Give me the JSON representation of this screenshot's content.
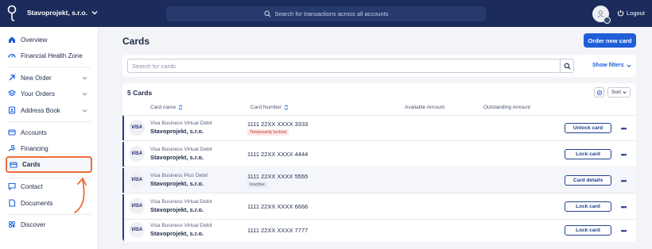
{
  "topbar": {
    "company": "Stavoprojekt, s.r.o.",
    "search_placeholder": "Search for transactions across all accounts",
    "logout_label": "Logout"
  },
  "sidebar": {
    "items": [
      {
        "label": "Overview",
        "icon": "home-icon"
      },
      {
        "label": "Financial Health Zone",
        "icon": "gauge-icon"
      },
      {
        "label": "New Order",
        "icon": "arrow-diagonal-icon"
      },
      {
        "label": "Your Orders",
        "icon": "orders-icon"
      },
      {
        "label": "Address Book",
        "icon": "address-book-icon"
      },
      {
        "label": "Accounts",
        "icon": "accounts-icon"
      },
      {
        "label": "Financing",
        "icon": "financing-icon"
      },
      {
        "label": "Cards",
        "icon": "card-icon"
      },
      {
        "label": "Contact",
        "icon": "chat-icon"
      },
      {
        "label": "Documents",
        "icon": "document-icon"
      },
      {
        "label": "Discover",
        "icon": "discover-icon"
      }
    ]
  },
  "main": {
    "title": "Cards",
    "order_button": "Order new card",
    "search_placeholder": "Search for cards",
    "show_filters": "Show filters",
    "count_label": "5 Cards",
    "sort_label": "Sort",
    "columns": {
      "card_name": "Card name",
      "card_number": "Card Number",
      "available": "Available Amount",
      "outstanding": "Outstanding Amount"
    },
    "rows": [
      {
        "brand": "VISA",
        "type": "Visa Business Virtual Debit",
        "name": "Stavoprojekt, s.r.o.",
        "number": "1111 22XX XXXX 3333",
        "tag": "Temporarily locked",
        "action": "Unlock card"
      },
      {
        "brand": "VISA",
        "type": "Visa Business Virtual Debit",
        "name": "Stavoprojekt, s.r.o.",
        "number": "1111 22XX XXXX 4444",
        "tag": "",
        "action": "Lock card"
      },
      {
        "brand": "VISA",
        "type": "Visa Business Plus Debit",
        "name": "Stavoprojekt, s.r.o.",
        "number": "1111 22XX XXXX 5555",
        "tag": "Inactive",
        "action": "Card details"
      },
      {
        "brand": "VISA",
        "type": "Visa Business Virtual Debit",
        "name": "Stavoprojekt, s.r.o.",
        "number": "1111 22XX XXXX 6666",
        "tag": "",
        "action": "Lock card"
      },
      {
        "brand": "VISA",
        "type": "Visa Business Virtual Debit",
        "name": "Stavoprojekt, s.r.o.",
        "number": "1111 22XX XXXX 7777",
        "tag": "",
        "action": "Lock card"
      }
    ],
    "more_label": "•••"
  },
  "colors": {
    "topbar": "#1b2b5b",
    "primary": "#1f5fd8",
    "highlight": "#ee6b3b"
  }
}
